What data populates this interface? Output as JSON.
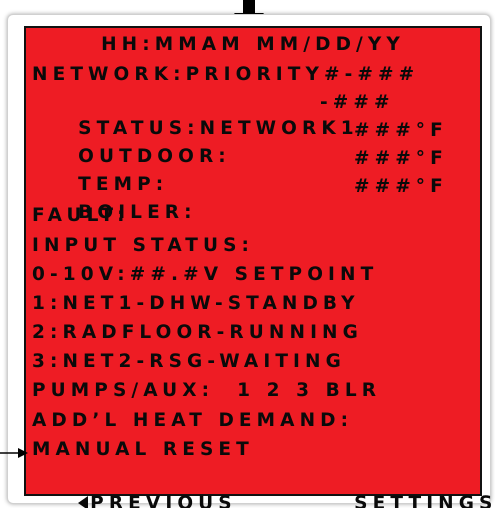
{
  "header": {
    "time_date": "HH:MMAM MM/DD/YY"
  },
  "lines": {
    "network": "NETWORK:PRIORITY#-###",
    "status_label": "STATUS:NETWORK1",
    "status_value": "-###",
    "outdoor_label": "OUTDOOR:",
    "outdoor_value": "###°F",
    "temp_label": "TEMP:",
    "temp_value": "###°F",
    "boiler_label": "BOILER:",
    "boiler_value": "###°F",
    "fault": "FAULT:",
    "input_status": "INPUT STATUS:",
    "analog_input": "0-10V:##.#V SETPOINT",
    "zone1": "1:NET1-DHW-STANDBY",
    "zone2": "2:RADFLOOR-RUNNING",
    "zone3": "3:NET2-RSG-WAITING",
    "pumps": "PUMPS/AUX:  1 2 3 BLR",
    "addl_heat": "ADD’L HEAT DEMAND:",
    "manual_reset": "MANUAL RESET"
  },
  "nav": {
    "previous_label": "PREVIOUS",
    "settings_label": "SETTINGS"
  },
  "colors": {
    "screen_background": "#ee1c24",
    "text": "#0a0a0a"
  },
  "icons": {
    "top_pointer": "down-arrow-icon",
    "side_pointer": "right-arrow-icon",
    "previous": "left-triangle-icon",
    "settings": "square-cursor-icon"
  }
}
